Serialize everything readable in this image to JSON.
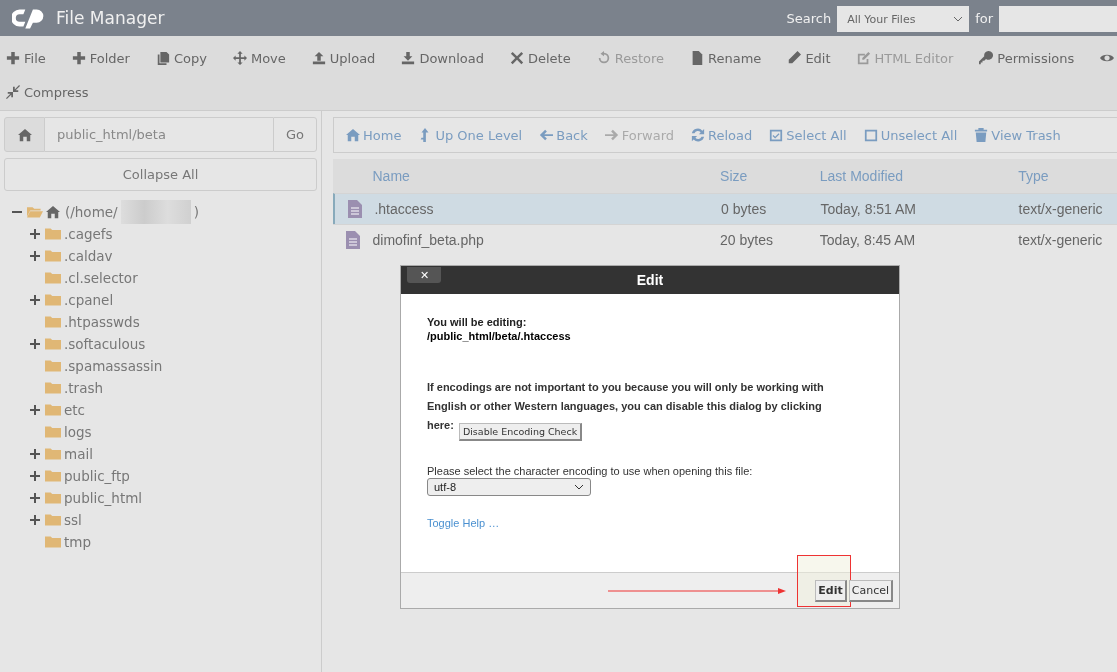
{
  "header": {
    "title": "File Manager",
    "search_label": "Search",
    "search_scope": "All Your Files",
    "for_label": "for"
  },
  "toolbar": [
    {
      "kind": "plus",
      "label": "File",
      "disabled": false
    },
    {
      "kind": "plus",
      "label": "Folder",
      "disabled": false
    },
    {
      "kind": "copy",
      "label": "Copy",
      "disabled": false
    },
    {
      "kind": "move",
      "label": "Move",
      "disabled": false
    },
    {
      "kind": "upload",
      "label": "Upload",
      "disabled": false
    },
    {
      "kind": "download",
      "label": "Download",
      "disabled": false
    },
    {
      "kind": "delete",
      "label": "Delete",
      "disabled": false
    },
    {
      "kind": "restore",
      "label": "Restore",
      "disabled": true
    },
    {
      "kind": "rename",
      "label": "Rename",
      "disabled": false
    },
    {
      "kind": "edit",
      "label": "Edit",
      "disabled": false
    },
    {
      "kind": "htmledit",
      "label": "HTML Editor",
      "disabled": true
    },
    {
      "kind": "key",
      "label": "Permissions",
      "disabled": false
    },
    {
      "kind": "eye",
      "disabled": false
    },
    {
      "kind": "compress",
      "label": "Compress",
      "disabled": false
    }
  ],
  "path_bar": {
    "value": "public_html/beta",
    "go": "Go"
  },
  "collapse_all": "Collapse All",
  "tree": {
    "label_start": "(/home/",
    "label_end": ")",
    "expanded": true,
    "children": [
      {
        "label": ".cagefs",
        "expandable": true,
        "expanded": false
      },
      {
        "label": ".caldav",
        "expandable": true,
        "expanded": false
      },
      {
        "label": ".cl.selector",
        "expandable": false
      },
      {
        "label": ".cpanel",
        "expandable": true,
        "expanded": false
      },
      {
        "label": ".htpasswds",
        "expandable": false
      },
      {
        "label": ".softaculous",
        "expandable": true,
        "expanded": false
      },
      {
        "label": ".spamassassin",
        "expandable": false
      },
      {
        "label": ".trash",
        "expandable": false
      },
      {
        "label": "etc",
        "expandable": true,
        "expanded": false
      },
      {
        "label": "logs",
        "expandable": false
      },
      {
        "label": "mail",
        "expandable": true,
        "expanded": false
      },
      {
        "label": "public_ftp",
        "expandable": true,
        "expanded": false
      },
      {
        "label": "public_html",
        "expandable": true,
        "expanded": false
      },
      {
        "label": "ssl",
        "expandable": true,
        "expanded": false
      },
      {
        "label": "tmp",
        "expandable": false
      }
    ]
  },
  "nav": [
    {
      "kind": "home",
      "label": "Home",
      "disabled": false
    },
    {
      "kind": "up",
      "label": "Up One Level",
      "disabled": false
    },
    {
      "kind": "back",
      "label": "Back",
      "disabled": false
    },
    {
      "kind": "forward",
      "label": "Forward",
      "disabled": true
    },
    {
      "kind": "reload",
      "label": "Reload",
      "disabled": false
    },
    {
      "kind": "selectall",
      "label": "Select All",
      "disabled": false
    },
    {
      "kind": "unselect",
      "label": "Unselect All",
      "disabled": false
    },
    {
      "kind": "trash",
      "label": "View Trash",
      "disabled": false
    }
  ],
  "table": {
    "columns": [
      "Name",
      "Size",
      "Last Modified",
      "Type"
    ],
    "rows": [
      {
        "name": ".htaccess",
        "size": "0 bytes",
        "modified": "Today, 8:51 AM",
        "type": "text/x-generic",
        "selected": true
      },
      {
        "name": "dimofinf_beta.php",
        "size": "20 bytes",
        "modified": "Today, 8:45 AM",
        "type": "text/x-generic",
        "selected": false
      }
    ]
  },
  "dialog": {
    "title": "Edit",
    "close": "✕",
    "editing_label": "You will be editing:",
    "editing_path": "/public_html/beta/.htaccess",
    "notice": "If encodings are not important to you because you will only be working with English or other Western languages, you can disable this dialog by clicking here:",
    "disable_button": "Disable Encoding Check",
    "encoding_label": "Please select the character encoding to use when opening this file:",
    "encoding": "utf-8",
    "toggle_help": "Toggle Help …",
    "buttons": [
      {
        "label": "Edit",
        "kind": "primary"
      },
      {
        "label": "Cancel",
        "kind": "secondary"
      }
    ]
  }
}
